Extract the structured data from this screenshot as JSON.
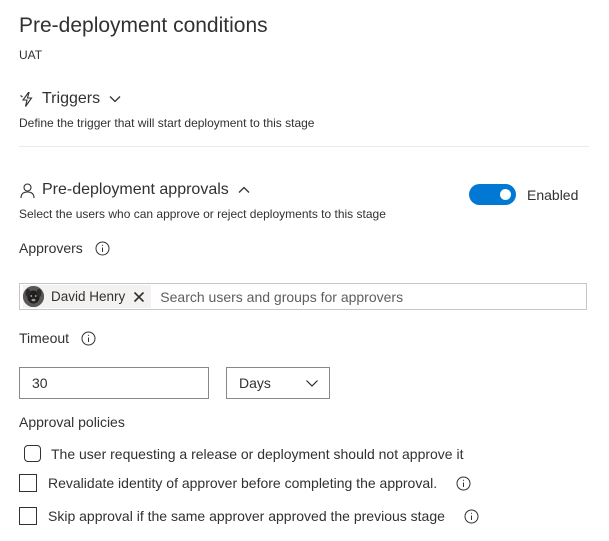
{
  "panel": {
    "title": "Pre-deployment conditions",
    "stage": "UAT"
  },
  "triggers": {
    "label": "Triggers",
    "description": "Define the trigger that will start deployment to this stage",
    "icon": "lightning-icon",
    "expanded": false
  },
  "approvals": {
    "label": "Pre-deployment approvals",
    "description": "Select the users who can approve or reject deployments to this stage",
    "icon": "person-icon",
    "expanded": true,
    "toggle_label": "Enabled",
    "enabled": true
  },
  "approvers": {
    "label": "Approvers",
    "selected": [
      {
        "name": "David Henry"
      }
    ],
    "search_placeholder": "Search users and groups for approvers"
  },
  "timeout": {
    "label": "Timeout",
    "value": "30",
    "unit": "Days"
  },
  "policies": {
    "label": "Approval policies",
    "items": [
      {
        "label": "The user requesting a release or deployment should not approve it",
        "checked": false,
        "info": false
      },
      {
        "label": "Revalidate identity of approver before completing the approval.",
        "checked": false,
        "info": true
      },
      {
        "label": "Skip approval if the same approver approved the previous stage",
        "checked": false,
        "info": true
      }
    ]
  },
  "colors": {
    "accent": "#0078d4",
    "text": "#323130",
    "border": "#8a8886",
    "divider": "#edebe9"
  }
}
